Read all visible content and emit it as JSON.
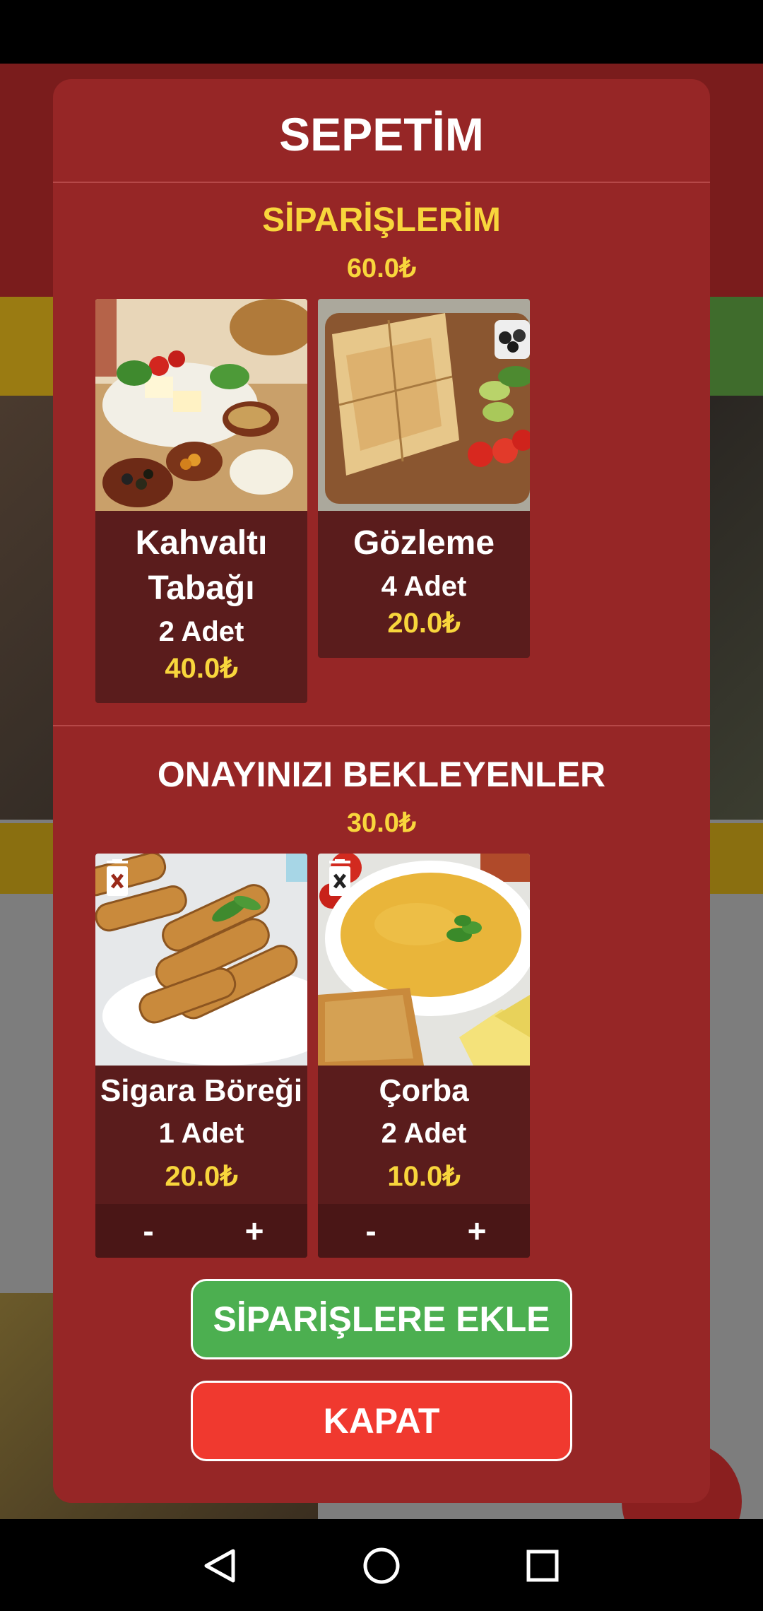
{
  "modal": {
    "title": "SEPETİM",
    "orders": {
      "title": "SİPARİŞLERİM",
      "total": "60.0₺",
      "items": [
        {
          "name": "Kahvaltı Tabağı",
          "qty": "2 Adet",
          "price": "40.0₺",
          "image": "breakfast-plate-photo"
        },
        {
          "name": "Gözleme",
          "qty": "4 Adet",
          "price": "20.0₺",
          "image": "gozleme-photo"
        }
      ]
    },
    "pending": {
      "title": "ONAYINIZI BEKLEYENLER",
      "total": "30.0₺",
      "items": [
        {
          "name": "Sigara Böreği",
          "qty": "1 Adet",
          "price": "20.0₺",
          "minus": "-",
          "plus": "+",
          "image": "sigara-boregi-photo"
        },
        {
          "name": "Çorba",
          "qty": "2 Adet",
          "price": "10.0₺",
          "minus": "-",
          "plus": "+",
          "image": "soup-photo"
        }
      ]
    },
    "add_button": "SİPARİŞLERE EKLE",
    "close_button": "KAPAT"
  },
  "icons": {
    "delete": "trash-icon",
    "back": "back-icon",
    "home": "home-icon",
    "recents": "recents-icon"
  },
  "colors": {
    "modal_bg": "#962626",
    "accent_yellow": "#f8d63c",
    "add_green": "#4caf50",
    "close_red": "#f0392f"
  }
}
